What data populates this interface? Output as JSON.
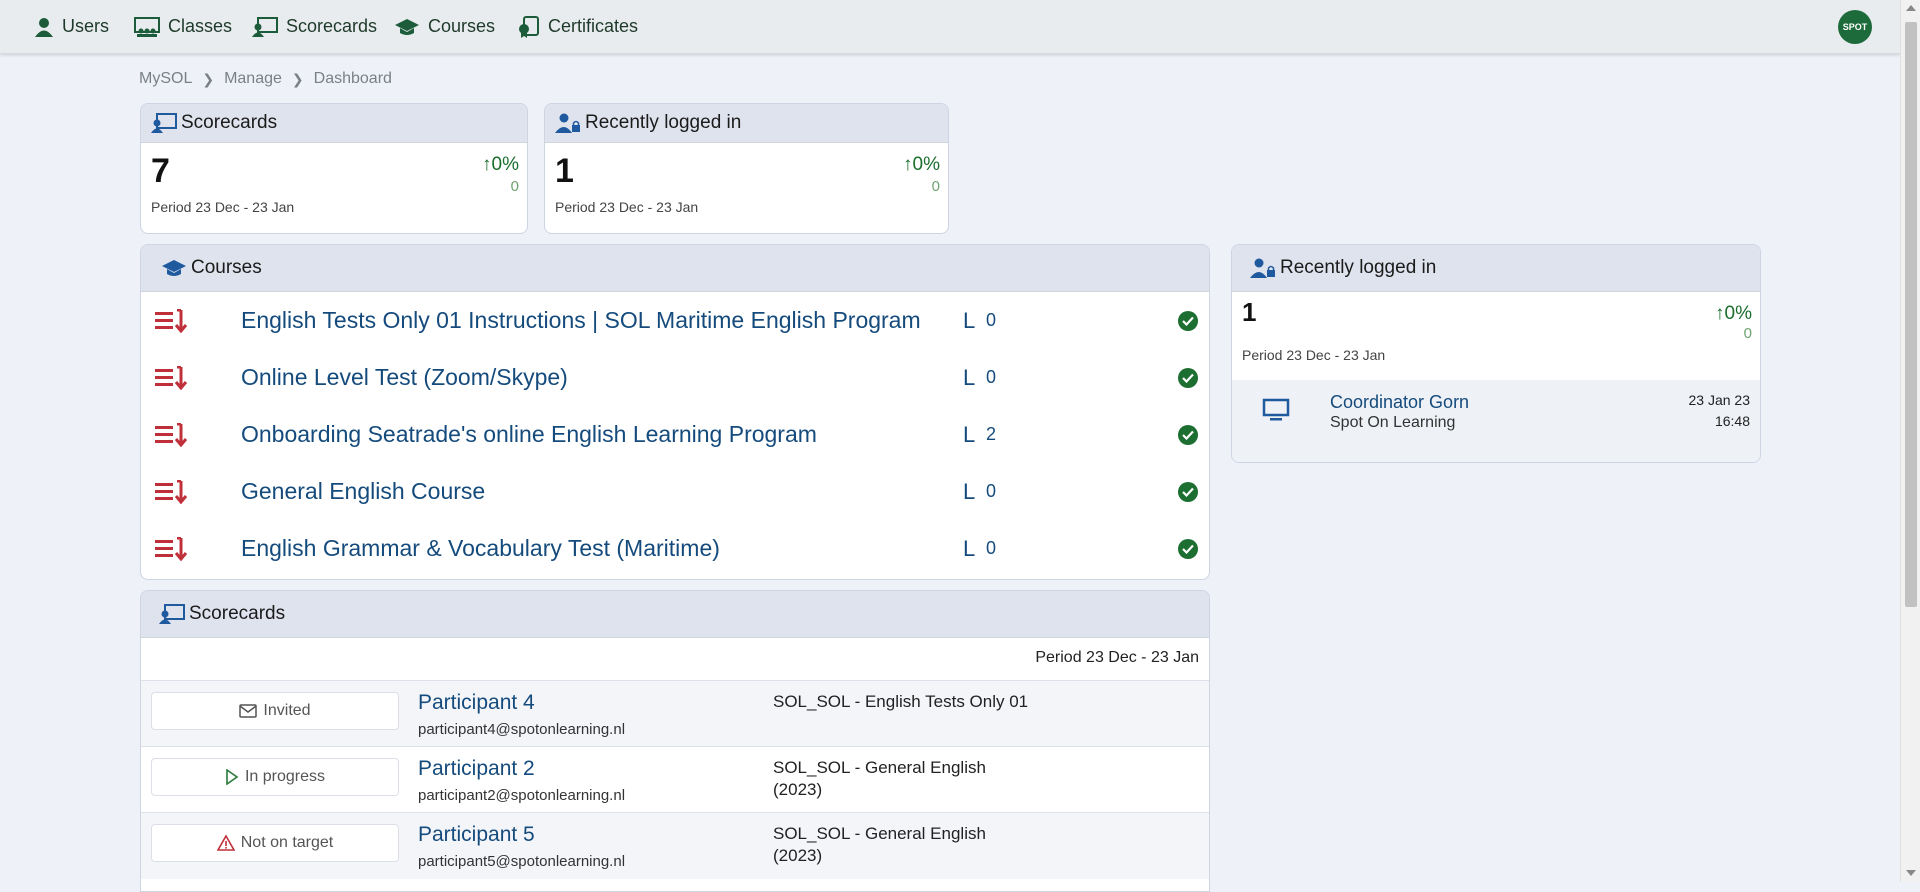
{
  "nav": {
    "items": [
      {
        "label": "Users",
        "icon": "user-icon"
      },
      {
        "label": "Classes",
        "icon": "classes-icon"
      },
      {
        "label": "Scorecards",
        "icon": "scorecards-icon"
      },
      {
        "label": "Courses",
        "icon": "graduation-cap-icon"
      },
      {
        "label": "Certificates",
        "icon": "certificate-icon"
      }
    ],
    "logo_text": "SPOT"
  },
  "breadcrumb": [
    "MySOL",
    "Manage",
    "Dashboard"
  ],
  "scorecards_summary": {
    "title": "Scorecards",
    "value": "7",
    "change_pct": "0%",
    "change_abs": "0",
    "period": "Period 23 Dec - 23 Jan"
  },
  "logged_in_summary": {
    "title": "Recently logged in",
    "value": "1",
    "change_pct": "0%",
    "change_abs": "0",
    "period": "Period 23 Dec - 23 Jan"
  },
  "courses": {
    "title": "Courses",
    "items": [
      {
        "title": "English Tests Only 01 Instructions | SOL Maritime English Program",
        "level": "L",
        "count": "0"
      },
      {
        "title": "Online Level Test (Zoom/Skype)",
        "level": "L",
        "count": "0"
      },
      {
        "title": "Onboarding Seatrade's online English Learning Program",
        "level": "L",
        "count": "2"
      },
      {
        "title": "General English Course",
        "level": "L",
        "count": "0"
      },
      {
        "title": "English Grammar & Vocabulary Test (Maritime)",
        "level": "L",
        "count": "0"
      }
    ]
  },
  "logged_in_panel": {
    "title": "Recently logged in",
    "value": "1",
    "change_pct": "0%",
    "change_abs": "0",
    "period": "Period 23 Dec - 23 Jan",
    "user": {
      "name": "Coordinator Gorn",
      "org": "Spot On Learning",
      "date": "23 Jan 23",
      "time": "16:48"
    }
  },
  "scorecards_list": {
    "title": "Scorecards",
    "period": "Period 23 Dec - 23 Jan",
    "rows": [
      {
        "status": "Invited",
        "status_icon": "envelope-icon",
        "name": "Participant 4",
        "email": "participant4@spotonlearning.nl",
        "course": "SOL_SOL - English Tests Only 01"
      },
      {
        "status": "In progress",
        "status_icon": "play-icon",
        "name": "Participant 2",
        "email": "participant2@spotonlearning.nl",
        "course": "SOL_SOL - General English (2023)"
      },
      {
        "status": "Not on target",
        "status_icon": "warning-icon",
        "name": "Participant 5",
        "email": "participant5@spotonlearning.nl",
        "course": "SOL_SOL - General English (2023)"
      }
    ]
  },
  "colors": {
    "accent": "#154b7c",
    "positive": "#1a6d2d",
    "danger": "#c0303a",
    "header_bg": "#dfe3ee"
  }
}
